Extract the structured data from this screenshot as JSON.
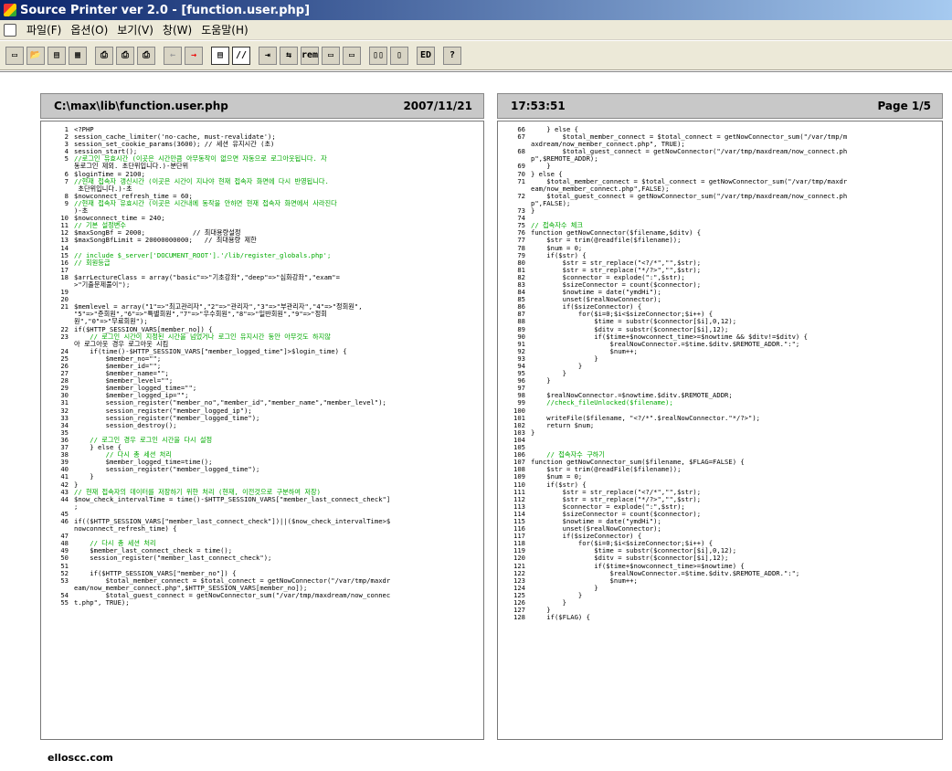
{
  "app": {
    "title": "Source Printer ver 2.0 - [function.user.php]"
  },
  "menu": {
    "items": [
      "파일(F)",
      "옵션(O)",
      "보기(V)",
      "창(W)",
      "도움말(H)"
    ]
  },
  "toolbar": {
    "buttons": [
      {
        "name": "new-icon",
        "glyph": "▭"
      },
      {
        "name": "open-folder-icon",
        "glyph": "📂"
      },
      {
        "name": "save-icon",
        "glyph": "▤"
      },
      {
        "name": "print-preview-icon",
        "glyph": "▦"
      },
      {
        "name": "print-icon",
        "glyph": "⎙"
      },
      {
        "name": "print-setup-icon",
        "glyph": "⎙"
      },
      {
        "name": "print-all-icon",
        "glyph": "⎙"
      },
      {
        "name": "arrow-left-icon",
        "glyph": "←"
      },
      {
        "name": "arrow-right-icon",
        "glyph": "→"
      },
      {
        "name": "line-number-icon",
        "glyph": "▤"
      },
      {
        "name": "comment-icon",
        "glyph": "//"
      },
      {
        "name": "indent-icon",
        "glyph": "⇥"
      },
      {
        "name": "tab-icon",
        "glyph": "⇆"
      },
      {
        "name": "rem-icon",
        "glyph": "rem"
      },
      {
        "name": "header-icon",
        "glyph": "▭"
      },
      {
        "name": "footer-icon",
        "glyph": "▭"
      },
      {
        "name": "two-page-icon",
        "glyph": "▯▯"
      },
      {
        "name": "one-page-icon",
        "glyph": "▯"
      },
      {
        "name": "editor-icon",
        "glyph": "ED"
      },
      {
        "name": "help-icon",
        "glyph": "?"
      }
    ]
  },
  "left_header": {
    "path": "C:\\max\\lib\\function.user.php",
    "date": "2007/11/21"
  },
  "right_header": {
    "time": "17:53:51",
    "page": "Page 1/5"
  },
  "left_lines": [
    {
      "n": "1",
      "t": "<?PHP"
    },
    {
      "n": "2",
      "t": "session_cache_limiter('no-cache, must-revalidate');"
    },
    {
      "n": "3",
      "t": "session_set_cookie_params(3600); // 세션 유지시간 (초)"
    },
    {
      "n": "4",
      "t": "session_start();"
    },
    {
      "n": "5",
      "t": "//로그인 유효시간 (이곳은 시간만큼 아무동작이 없으면 자동으로 로그아웃됩니다. 자"
    },
    {
      "n": "",
      "t": "동로그인 제외. 초단위입니다.)-분단위"
    },
    {
      "n": "6",
      "t": "$loginTime = 2100;"
    },
    {
      "n": "7",
      "t": "//현재 접속자 갱신시간 (이곳은 시간이 지나야 현재 접속자 화면에 다시 반영됩니다."
    },
    {
      "n": "",
      "t": " 초단위입니다.)-초"
    },
    {
      "n": "8",
      "t": "$nowconnect_refresh_time = 60;"
    },
    {
      "n": "9",
      "t": "//현재 접속자 유효시간 (이곳은 시간내에 동작을 안하면 현재 접속자 화면에서 사라진다"
    },
    {
      "n": "",
      "t": ")-초"
    },
    {
      "n": "10",
      "t": "$nowconnect_time = 240;"
    },
    {
      "n": "11",
      "t": "// 기본 설정변수"
    },
    {
      "n": "12",
      "t": "$maxSongBf = 2000;            // 최대용량설정"
    },
    {
      "n": "13",
      "t": "$maxSongBfLimit = 20000000000;   // 최대용량 제한"
    },
    {
      "n": "14",
      "t": ""
    },
    {
      "n": "15",
      "t": "// include $_server['DOCUMENT_ROOT'].'/lib/register_globals.php';"
    },
    {
      "n": "16",
      "t": "// 회원등급"
    },
    {
      "n": "17",
      "t": ""
    },
    {
      "n": "18",
      "t": "$arrLectureClass = array(\"basic\"=>\"기초강좌\",\"deep\"=>\"심화강좌\",\"exam\"="
    },
    {
      "n": "",
      "t": ">\"기출문제풀이\");"
    },
    {
      "n": "19",
      "t": ""
    },
    {
      "n": "20",
      "t": ""
    },
    {
      "n": "21",
      "t": "$memlevel = array(\"1\"=>\"최고관리자\",\"2\"=>\"관리자\",\"3\"=>\"부관리자\",\"4\"=>\"정회원\","
    },
    {
      "n": "",
      "t": "\"5\"=>\"준회원\",\"6\"=>\"특별회원\",\"7\"=>\"우수회원\",\"8\"=>\"일반회원\",\"9\"=>\"정회"
    },
    {
      "n": "",
      "t": "원\",\"0\"=>\"무료회원\");"
    },
    {
      "n": "22",
      "t": "if($HTTP_SESSION_VARS[member_no]) {"
    },
    {
      "n": "23",
      "t": "    // 로그인 시간이 지정된 시간을 넘었거나 로그인 유지시간 동안 아무것도 하지않"
    },
    {
      "n": "",
      "t": "아 로그아웃 경우 로그아웃 시킴"
    },
    {
      "n": "24",
      "t": "    if(time()-$HTTP_SESSION_VARS[\"member_logged_time\"]>$login_time) {"
    },
    {
      "n": "25",
      "t": "        $member_no=\"\";"
    },
    {
      "n": "26",
      "t": "        $member_id=\"\";"
    },
    {
      "n": "27",
      "t": "        $member_name=\"\";"
    },
    {
      "n": "28",
      "t": "        $member_level=\"\";"
    },
    {
      "n": "29",
      "t": "        $member_logged_time=\"\";"
    },
    {
      "n": "30",
      "t": "        $member_logged_ip=\"\";"
    },
    {
      "n": "31",
      "t": "        session_register(\"member_no\",\"member_id\",\"member_name\",\"member_level\");"
    },
    {
      "n": "32",
      "t": "        session_register(\"member_logged_ip\");"
    },
    {
      "n": "33",
      "t": "        session_register(\"member_logged_time\");"
    },
    {
      "n": "34",
      "t": "        session_destroy();"
    },
    {
      "n": "35",
      "t": ""
    },
    {
      "n": "36",
      "t": "    // 로그인 경우 로그인 시간을 다시 설정"
    },
    {
      "n": "37",
      "t": "    } else {"
    },
    {
      "n": "38",
      "t": "        // 다시 총 세션 처리"
    },
    {
      "n": "39",
      "t": "        $member_logged_time=time();"
    },
    {
      "n": "40",
      "t": "        session_register(\"member_logged_time\");"
    },
    {
      "n": "41",
      "t": "    }"
    },
    {
      "n": "42",
      "t": "}"
    },
    {
      "n": "43",
      "t": "// 현재 접속자의 데이터를 저장하기 위한 처리 (현재, 이전것으로 구분하여 저장)"
    },
    {
      "n": "44",
      "t": "$now_check_intervalTime = time()-$HTTP_SESSION_VARS[\"member_last_connect_check\"]"
    },
    {
      "n": "",
      "t": ";"
    },
    {
      "n": "45",
      "t": ""
    },
    {
      "n": "46",
      "t": "if(($HTTP_SESSION_VARS[\"member_last_connect_check\"])||($now_check_intervalTime>$"
    },
    {
      "n": "",
      "t": "nowconnect_refresh_time) {"
    },
    {
      "n": "47",
      "t": ""
    },
    {
      "n": "48",
      "t": "    // 다시 총 세션 처리"
    },
    {
      "n": "49",
      "t": "    $member_last_connect_check = time();"
    },
    {
      "n": "50",
      "t": "    session_register(\"member_last_connect_check\");"
    },
    {
      "n": "51",
      "t": ""
    },
    {
      "n": "52",
      "t": "    if($HTTP_SESSION_VARS[\"member_no\"]) {"
    },
    {
      "n": "53",
      "t": "        $total_member_connect = $total_connect = getNowConnector(\"/var/tmp/maxdr"
    },
    {
      "n": "",
      "t": "eam/now_member_connect.php\",$HTTP_SESSION_VARS[member_no]);"
    },
    {
      "n": "54",
      "t": "        $total_guest_connect = getNowConnector_sum(\"/var/tmp/maxdream/now_connec"
    },
    {
      "n": "55",
      "t": "t.php\", TRUE);"
    }
  ],
  "right_lines": [
    {
      "n": "66",
      "t": "    } else {"
    },
    {
      "n": "67",
      "t": "        $total_member_connect = $total_connect = getNowConnector_sum(\"/var/tmp/m"
    },
    {
      "n": "",
      "t": "axdream/now_member_connect.php\", TRUE);"
    },
    {
      "n": "68",
      "t": "        $total_guest_connect = getNowConnector(\"/var/tmp/maxdream/now_connect.ph"
    },
    {
      "n": "",
      "t": "p\",$REMOTE_ADDR);"
    },
    {
      "n": "69",
      "t": "    }"
    },
    {
      "n": "70",
      "t": "} else {"
    },
    {
      "n": "71",
      "t": "    $total_member_connect = $total_connect = getNowConnector_sum(\"/var/tmp/maxdr"
    },
    {
      "n": "",
      "t": "eam/now_member_connect.php\",FALSE);"
    },
    {
      "n": "72",
      "t": "    $total_guest_connect = getNowConnector_sum(\"/var/tmp/maxdream/now_connect.ph"
    },
    {
      "n": "",
      "t": "p\",FALSE);"
    },
    {
      "n": "73",
      "t": "}"
    },
    {
      "n": "74",
      "t": ""
    },
    {
      "n": "75",
      "t": "// 접속자수 체크"
    },
    {
      "n": "76",
      "t": "function getNowConnector($filename,$ditv) {"
    },
    {
      "n": "77",
      "t": "    $str = trim(@readfile($filename));"
    },
    {
      "n": "78",
      "t": "    $num = 0;"
    },
    {
      "n": "79",
      "t": "    if($str) {"
    },
    {
      "n": "80",
      "t": "        $str = str_replace(\"<?/*\",\"\",$str);"
    },
    {
      "n": "81",
      "t": "        $str = str_replace(\"*/?>\",\"\",$str);"
    },
    {
      "n": "82",
      "t": "        $connector = explode(\":\",$str);"
    },
    {
      "n": "83",
      "t": "        $sizeConnector = count($connector);"
    },
    {
      "n": "84",
      "t": "        $nowtime = date(\"ymdHi\");"
    },
    {
      "n": "85",
      "t": "        unset($realNowConnector);"
    },
    {
      "n": "86",
      "t": "        if($sizeConnector) {"
    },
    {
      "n": "87",
      "t": "            for($i=0;$i<$sizeConnector;$i++) {"
    },
    {
      "n": "88",
      "t": "                $time = substr($connector[$i],0,12);"
    },
    {
      "n": "89",
      "t": "                $ditv = substr($connector[$i],12);"
    },
    {
      "n": "90",
      "t": "                if($time+$nowconnect_time>=$nowtime && $ditv!=$ditv) {"
    },
    {
      "n": "91",
      "t": "                    $realNowConnector.=$time.$ditv.$REMOTE_ADDR.\":\";"
    },
    {
      "n": "92",
      "t": "                    $num++;"
    },
    {
      "n": "93",
      "t": "                }"
    },
    {
      "n": "94",
      "t": "            }"
    },
    {
      "n": "95",
      "t": "        }"
    },
    {
      "n": "96",
      "t": "    }"
    },
    {
      "n": "97",
      "t": ""
    },
    {
      "n": "98",
      "t": "    $realNowConnector.=$nowtime.$ditv.$REMOTE_ADDR;"
    },
    {
      "n": "99",
      "t": "    //check_fileUnlocked($filename);"
    },
    {
      "n": "100",
      "t": ""
    },
    {
      "n": "101",
      "t": "    writeFile($filename, \"<?/*\".$realNowConnector.\"*/?>\");"
    },
    {
      "n": "102",
      "t": "    return $num;"
    },
    {
      "n": "103",
      "t": "}"
    },
    {
      "n": "104",
      "t": ""
    },
    {
      "n": "105",
      "t": ""
    },
    {
      "n": "106",
      "t": "    // 접속자수 구하기"
    },
    {
      "n": "107",
      "t": "function getNowConnector_sum($filename, $FLAG=FALSE) {"
    },
    {
      "n": "108",
      "t": "    $str = trim(@readFile($filename));"
    },
    {
      "n": "109",
      "t": "    $num = 0;"
    },
    {
      "n": "110",
      "t": "    if($str) {"
    },
    {
      "n": "111",
      "t": "        $str = str_replace(\"<?/*\",\"\",$str);"
    },
    {
      "n": "112",
      "t": "        $str = str_replace(\"*/?>\",\"\",$str);"
    },
    {
      "n": "113",
      "t": "        $connector = explode(\":\",$str);"
    },
    {
      "n": "114",
      "t": "        $sizeConnector = count($connector);"
    },
    {
      "n": "115",
      "t": "        $nowtime = date(\"ymdHi\");"
    },
    {
      "n": "116",
      "t": "        unset($realNowConnector);"
    },
    {
      "n": "117",
      "t": "        if($sizeConnector) {"
    },
    {
      "n": "118",
      "t": "            for($i=0;$i<$sizeConnector;$i++) {"
    },
    {
      "n": "119",
      "t": "                $time = substr($connector[$i],0,12);"
    },
    {
      "n": "120",
      "t": "                $ditv = substr($connector[$i],12);"
    },
    {
      "n": "121",
      "t": "                if($time+$nowconnect_time>=$nowtime) {"
    },
    {
      "n": "122",
      "t": "                    $realNowConnector.=$time.$ditv.$REMOTE_ADDR.\":\";"
    },
    {
      "n": "123",
      "t": "                    $num++;"
    },
    {
      "n": "124",
      "t": "                }"
    },
    {
      "n": "125",
      "t": "            }"
    },
    {
      "n": "126",
      "t": "        }"
    },
    {
      "n": "127",
      "t": "    }"
    },
    {
      "n": "128",
      "t": "    if($FLAG) {"
    }
  ],
  "footer": {
    "text": "elloscc.com"
  }
}
